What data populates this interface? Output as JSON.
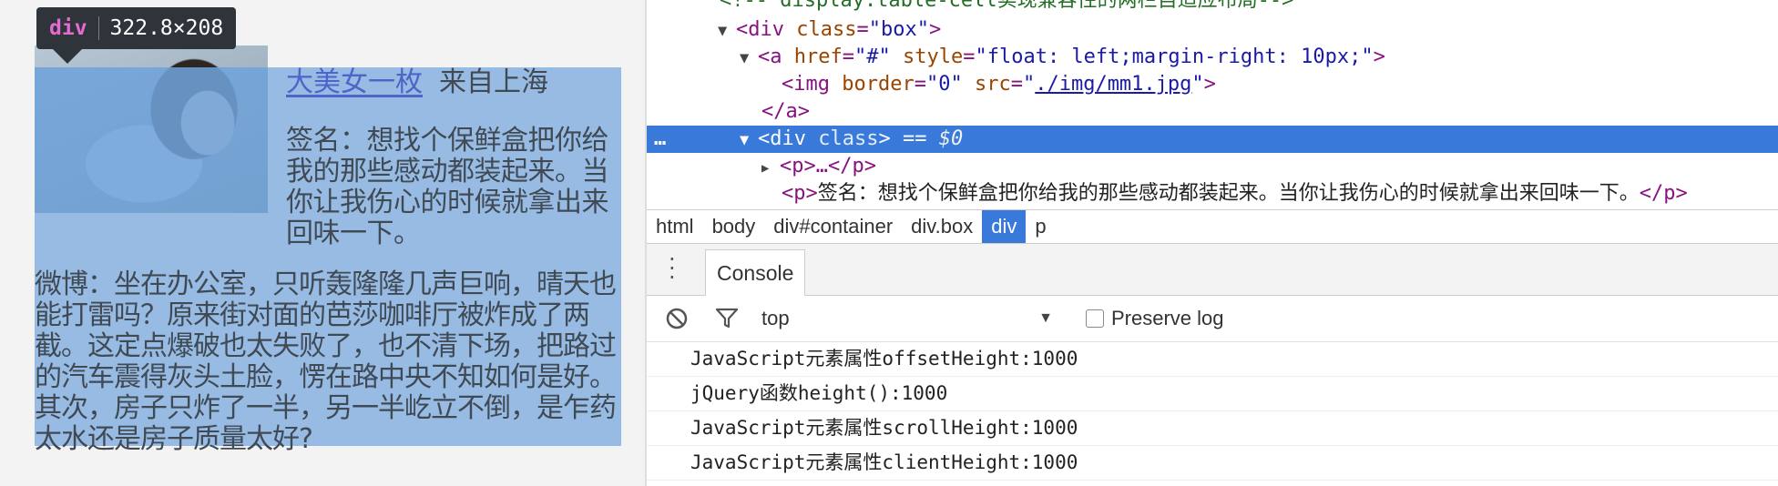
{
  "inspect_tooltip": {
    "tag": "div",
    "size": "322.8×208"
  },
  "page": {
    "name_link": "大美女一枚",
    "from": "来自上海",
    "signature": "签名：想找个保鲜盒把你给我的那些感动都装起来。当你让我伤心的时候就拿出来回味一下。",
    "weibo": "微博：坐在办公室，只听轰隆隆几声巨响，晴天也能打雷吗？原来街对面的芭莎咖啡厅被炸成了两截。这定点爆破也太失败了，也不清下场，把路过的汽车震得灰头土脸，愣在路中央不知如何是好。其次，房子只炸了一半，另一半屹立不倒，是乍药太水还是房子质量太好?"
  },
  "elements_tree": {
    "comment_line": "<!-- display:table-cell实现兼容性的两栏自适应布局-->",
    "div_box": {
      "open": "<div",
      "attr": "class",
      "value": "\"box\"",
      "close": ">"
    },
    "a_tag": {
      "open": "<a",
      "href_attr": "href",
      "href_val": "\"#\"",
      "style_attr": "style",
      "style_val": "\"float: left;margin-right: 10px;\"",
      "close": ">"
    },
    "img_tag": {
      "open": "<img",
      "border_attr": "border",
      "border_val": "\"0\"",
      "src_attr": "src",
      "src_val": "./img/mm1.jpg",
      "close": ">"
    },
    "a_close": "</a>",
    "selected": {
      "dots": "…",
      "open": "<div",
      "attr": "class",
      "close": ">",
      "eq": "==",
      "dollar": "$0"
    },
    "p_collapsed": "<p>…</p>",
    "p_signature": {
      "open": "<p>",
      "text": "签名：想找个保鲜盒把你给我的那些感动都装起来。当你让我伤心的时候就拿出来回味一下。",
      "close": "</p>"
    }
  },
  "breadcrumb": [
    "html",
    "body",
    "div#container",
    "div.box",
    "div",
    "p"
  ],
  "breadcrumb_active_index": 4,
  "drawer": {
    "tab": "Console"
  },
  "console_toolbar": {
    "context": "top",
    "preserve_log": "Preserve log",
    "preserve_checked": false
  },
  "console_log": [
    "JavaScript元素属性offsetHeight:1000",
    "jQuery函数height():1000",
    "JavaScript元素属性scrollHeight:1000",
    "JavaScript元素属性clientHeight:1000"
  ],
  "colors": {
    "highlight": "#6fa2da",
    "selection": "#3879d9",
    "tag": "#881280",
    "attr_name": "#994500",
    "attr_value": "#1a1aa6"
  }
}
